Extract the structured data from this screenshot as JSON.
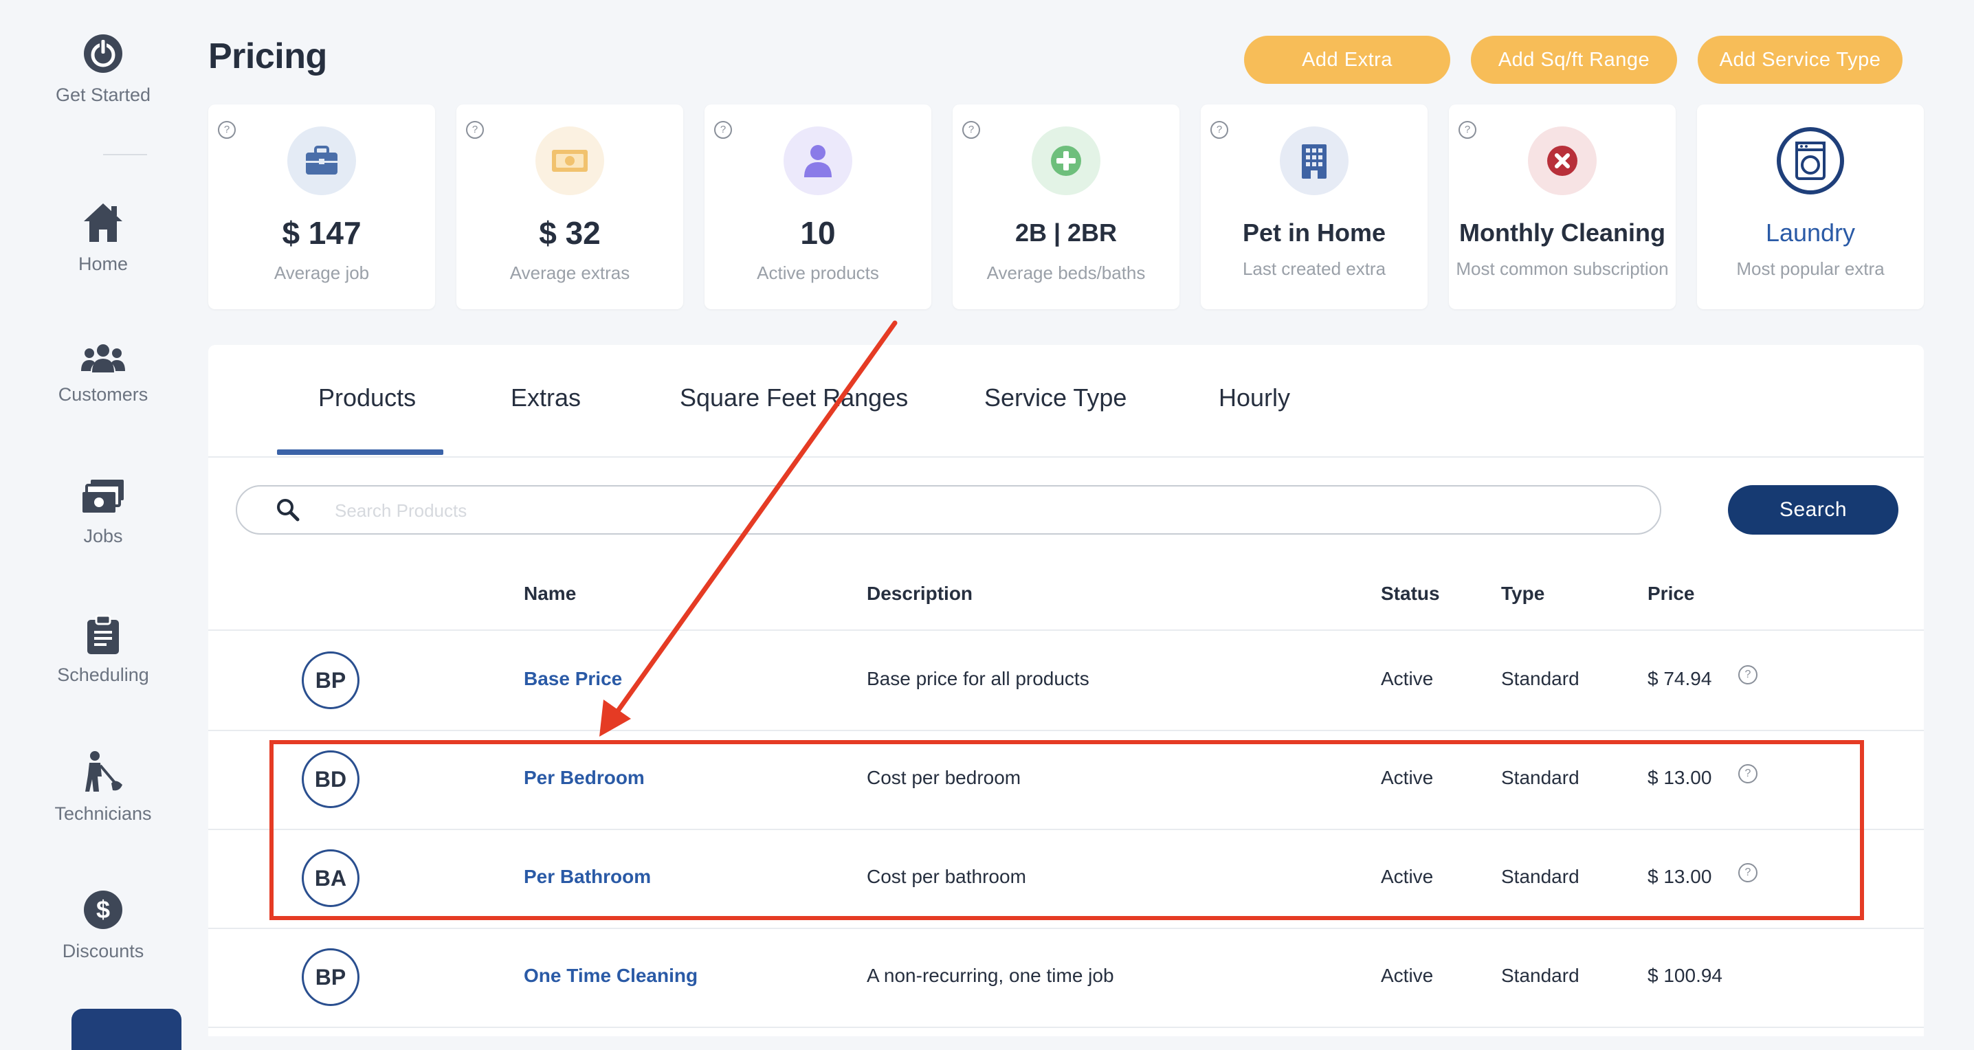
{
  "sidebar": {
    "items": [
      {
        "label": "Get Started",
        "icon": "power-icon"
      },
      {
        "label": "Home",
        "icon": "home-icon"
      },
      {
        "label": "Customers",
        "icon": "users-icon"
      },
      {
        "label": "Jobs",
        "icon": "money-stack-icon"
      },
      {
        "label": "Scheduling",
        "icon": "clipboard-icon"
      },
      {
        "label": "Technicians",
        "icon": "cleaner-icon"
      },
      {
        "label": "Discounts",
        "icon": "dollar-circle-icon"
      }
    ]
  },
  "header": {
    "title": "Pricing",
    "buttons": {
      "add_extra": "Add Extra",
      "add_sqft_range": "Add Sq/ft Range",
      "add_service_type": "Add Service Type"
    }
  },
  "stats": [
    {
      "value": "$ 147",
      "caption": "Average job",
      "icon": "briefcase-icon"
    },
    {
      "value": "$ 32",
      "caption": "Average extras",
      "icon": "banknote-icon"
    },
    {
      "value": "10",
      "caption": "Active products",
      "icon": "person-icon"
    },
    {
      "value": "2B | 2BR",
      "caption": "Average beds/baths",
      "icon": "plus-circle-icon"
    },
    {
      "value": "Pet in Home",
      "caption": "Last created extra",
      "icon": "building-icon"
    },
    {
      "value": "Monthly Cleaning",
      "caption": "Most common subscription",
      "icon": "x-circle-icon"
    },
    {
      "value": "Laundry",
      "caption": "Most popular extra",
      "icon": "washing-machine-icon"
    }
  ],
  "tabs": [
    "Products",
    "Extras",
    "Square Feet Ranges",
    "Service Type",
    "Hourly"
  ],
  "search": {
    "placeholder": "Search Products",
    "button": "Search"
  },
  "table": {
    "columns": [
      "Name",
      "Description",
      "Status",
      "Type",
      "Price"
    ],
    "rows": [
      {
        "badge": "BP",
        "name": "Base Price",
        "description": "Base price for all products",
        "status": "Active",
        "type": "Standard",
        "price": "$ 74.94"
      },
      {
        "badge": "BD",
        "name": "Per Bedroom",
        "description": "Cost per bedroom",
        "status": "Active",
        "type": "Standard",
        "price": "$ 13.00"
      },
      {
        "badge": "BA",
        "name": "Per Bathroom",
        "description": "Cost per bathroom",
        "status": "Active",
        "type": "Standard",
        "price": "$ 13.00"
      },
      {
        "badge": "BP",
        "name": "One Time Cleaning",
        "description": "A non-recurring, one time job",
        "status": "Active",
        "type": "Standard",
        "price": "$ 100.94"
      }
    ]
  },
  "help_glyph": "?",
  "colors": {
    "accent_orange": "#f7bd58",
    "primary_navy": "#163a72",
    "link_blue": "#2a5aa6",
    "annotation_red": "#e53b24"
  }
}
